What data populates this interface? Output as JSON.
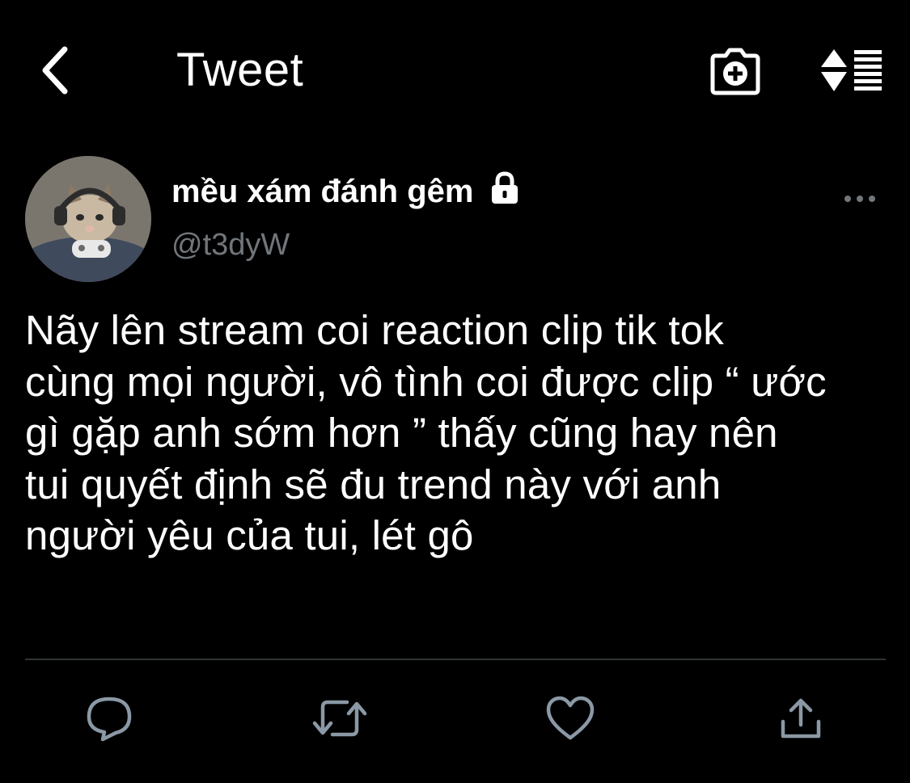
{
  "header": {
    "title": "Tweet",
    "back_icon": "chevron-left-icon",
    "camera_icon": "camera-add-icon",
    "sort_icon": "sort-list-icon"
  },
  "tweet": {
    "display_name": "mều xám đánh gêm",
    "handle": "@t3dyW",
    "protected_icon": "lock-icon",
    "more_icon": "more-horizontal-icon",
    "text": "Nãy lên stream coi reaction clip tik tok\ncùng mọi người, vô tình coi được clip “ ước\ngì gặp anh sớm hơn ” thấy cũng hay nên\ntui quyết định sẽ đu trend này với anh\nngười yêu của tui, lét gô"
  },
  "actions": [
    {
      "name": "reply",
      "icon": "reply-icon"
    },
    {
      "name": "retweet",
      "icon": "retweet-icon"
    },
    {
      "name": "like",
      "icon": "heart-icon"
    },
    {
      "name": "share",
      "icon": "share-icon"
    }
  ],
  "colors": {
    "background": "#000000",
    "text": "#ffffff",
    "secondary": "#71767b",
    "divider": "#2f3336",
    "icon_muted": "#8b98a5"
  }
}
